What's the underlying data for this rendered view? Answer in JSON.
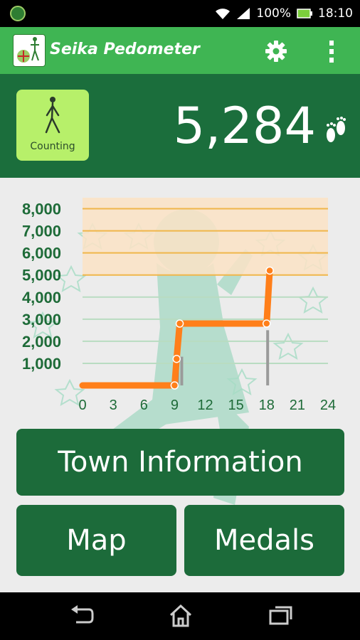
{
  "status_bar": {
    "battery": "100%",
    "time": "18:10"
  },
  "app": {
    "title": "Seika Pedometer"
  },
  "header": {
    "mode_label": "Counting",
    "step_count": "5,284"
  },
  "chart_data": {
    "type": "line",
    "x_ticks": [
      "0",
      "3",
      "6",
      "9",
      "12",
      "15",
      "18",
      "21",
      "24"
    ],
    "y_ticks": [
      "1,000",
      "2,000",
      "3,000",
      "4,000",
      "5,000",
      "6,000",
      "7,000",
      "8,000"
    ],
    "xlim": [
      0,
      24
    ],
    "ylim": [
      0,
      8500
    ],
    "goal": 5000,
    "series": [
      {
        "x": [
          0,
          9,
          9.2,
          9.5,
          18,
          18.3
        ],
        "y": [
          0,
          0,
          1200,
          2800,
          2800,
          5200
        ]
      }
    ],
    "hourly_bars": [
      {
        "x": 9.3,
        "y": 1300
      },
      {
        "x": 9.7,
        "y": 1300
      },
      {
        "x": 18.1,
        "y": 2500
      }
    ],
    "colors": {
      "line": "#ff7f1a",
      "goal_band": "#fbe3c6",
      "goal_lines": "#f0b64a",
      "grid": "#b9dcc1",
      "tick_labels": "#1e6b38",
      "bars": "#9a9a9a"
    }
  },
  "buttons": {
    "town": "Town Information",
    "map": "Map",
    "medals": "Medals"
  },
  "icons": [
    "app-logo-icon",
    "wifi-icon",
    "signal-icon",
    "battery-icon",
    "gear-icon",
    "overflow-menu-icon",
    "walking-person-icon",
    "footprint-icon",
    "back-icon",
    "home-icon",
    "recent-apps-icon"
  ],
  "colors": {
    "appbar": "#3fb553",
    "header": "#1b6e3c",
    "button": "#1c6b3a",
    "counting": "#b7f06a"
  }
}
